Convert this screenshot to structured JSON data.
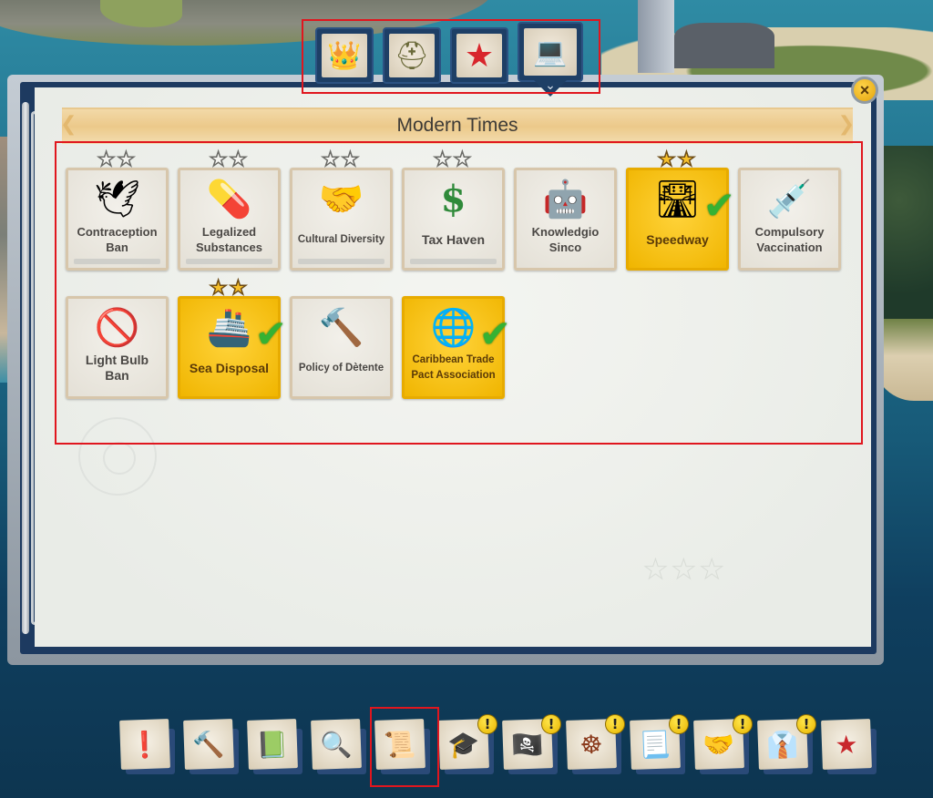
{
  "category_tabs": [
    {
      "name": "monarchy",
      "icon": "crown-icon",
      "glyph": "👑",
      "active": false
    },
    {
      "name": "world-wars",
      "icon": "helmet-icon",
      "glyph": "⛑",
      "active": false
    },
    {
      "name": "cold-war",
      "icon": "red-star-icon",
      "glyph": "★",
      "active": false
    },
    {
      "name": "modern-times",
      "icon": "laptop-icon",
      "glyph": "💻",
      "active": true
    }
  ],
  "panel": {
    "title": "Modern Times",
    "close_icon": "×"
  },
  "policies": [
    {
      "label": "Contraception Ban",
      "icon": "stork-icon",
      "glyph": "🕊",
      "stars": 2,
      "stars_earned": 0,
      "enacted": false,
      "has_progress": true,
      "size": "normal"
    },
    {
      "label": "Legalized Substances",
      "icon": "pills-icon",
      "glyph": "💊",
      "stars": 2,
      "stars_earned": 0,
      "enacted": false,
      "has_progress": true,
      "size": "normal"
    },
    {
      "label": "Cultural Diversity",
      "icon": "hands-icon",
      "glyph": "🤝",
      "stars": 2,
      "stars_earned": 0,
      "enacted": false,
      "has_progress": true,
      "size": "small"
    },
    {
      "label": "Tax Haven",
      "icon": "dollar-icon",
      "glyph": "$",
      "stars": 2,
      "stars_earned": 0,
      "enacted": false,
      "has_progress": true,
      "size": "big"
    },
    {
      "label": "Knowledgio Sinco",
      "icon": "robot-icon",
      "glyph": "🤖",
      "stars": 0,
      "stars_earned": 0,
      "enacted": false,
      "has_progress": false,
      "size": "normal"
    },
    {
      "label": "Speedway",
      "icon": "road-icon",
      "glyph": "🛣",
      "stars": 2,
      "stars_earned": 2,
      "enacted": true,
      "has_progress": false,
      "size": "big"
    },
    {
      "label": "Compulsory Vaccination",
      "icon": "syringe-icon",
      "glyph": "💉",
      "stars": 0,
      "stars_earned": 0,
      "enacted": false,
      "has_progress": false,
      "size": "normal"
    },
    {
      "label": "Light Bulb Ban",
      "icon": "no-lightbulb-icon",
      "glyph": "🚫",
      "stars": 0,
      "stars_earned": 0,
      "enacted": false,
      "has_progress": false,
      "size": "big"
    },
    {
      "label": "Sea Disposal",
      "icon": "garbage-ship-icon",
      "glyph": "🚢",
      "stars": 2,
      "stars_earned": 2,
      "enacted": true,
      "has_progress": false,
      "size": "big"
    },
    {
      "label": "Policy of Dètente",
      "icon": "gavel-icon",
      "glyph": "🔨",
      "stars": 0,
      "stars_earned": 0,
      "enacted": false,
      "has_progress": false,
      "size": "small"
    },
    {
      "label": "Caribbean Trade Pact Association",
      "icon": "globe-icon",
      "glyph": "🌐",
      "stars": 0,
      "stars_earned": 0,
      "enacted": true,
      "has_progress": false,
      "size": "small"
    }
  ],
  "check_glyph": "✔",
  "toolbar": [
    {
      "name": "alerts",
      "icon": "exclamation-icon",
      "glyph": "❗",
      "alert": false,
      "selected": false
    },
    {
      "name": "build",
      "icon": "hammer-icon",
      "glyph": "🔨",
      "alert": false,
      "selected": false
    },
    {
      "name": "almanac",
      "icon": "book-icon",
      "glyph": "📗",
      "alert": false,
      "selected": false
    },
    {
      "name": "overlays",
      "icon": "magnifier-map-icon",
      "glyph": "🔍",
      "alert": false,
      "selected": false
    },
    {
      "name": "edicts",
      "icon": "scroll-icon",
      "glyph": "📜",
      "alert": false,
      "selected": true
    },
    {
      "name": "research",
      "icon": "graduation-books-icon",
      "glyph": "🎓",
      "alert": true,
      "selected": false
    },
    {
      "name": "missions",
      "icon": "pirate-flag-icon",
      "glyph": "🏴‍☠️",
      "alert": true,
      "selected": false
    },
    {
      "name": "trade",
      "icon": "ship-wheel-icon",
      "glyph": "☸",
      "alert": true,
      "selected": false
    },
    {
      "name": "constitution",
      "icon": "sealed-scroll-icon",
      "glyph": "📃",
      "alert": true,
      "selected": false
    },
    {
      "name": "diplomacy",
      "icon": "handshake-globe-icon",
      "glyph": "🤝",
      "alert": true,
      "selected": false
    },
    {
      "name": "ministry",
      "icon": "suit-icon",
      "glyph": "👔",
      "alert": true,
      "selected": false
    },
    {
      "name": "factions",
      "icon": "faction-star-icon",
      "glyph": "★",
      "alert": false,
      "selected": false
    }
  ],
  "alert_glyph": "!",
  "star_glyph": "★"
}
